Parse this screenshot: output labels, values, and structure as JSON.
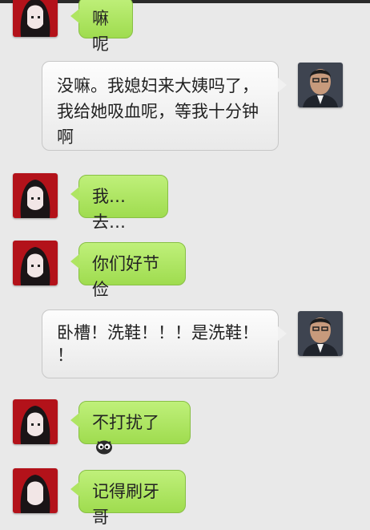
{
  "messages": [
    {
      "side": "left",
      "text": "嘛呢"
    },
    {
      "side": "right",
      "lines": [
        "没嘛。我媳妇来大姨吗了，",
        "我给她吸血呢，等我十分钟",
        "啊"
      ]
    },
    {
      "side": "left",
      "text": "我…去…"
    },
    {
      "side": "left",
      "text": "你们好节俭"
    },
    {
      "side": "right",
      "lines": [
        "卧槽！洗鞋！！！是洗鞋！",
        "！"
      ]
    },
    {
      "side": "left",
      "text": "不打扰了",
      "emoji": "owl-face-emoji"
    },
    {
      "side": "left",
      "text": "记得刷牙哥"
    }
  ],
  "colors": {
    "background": "#e9e9e9",
    "green_bubble": "#a8e05b",
    "white_bubble": "#f4f4f4"
  }
}
